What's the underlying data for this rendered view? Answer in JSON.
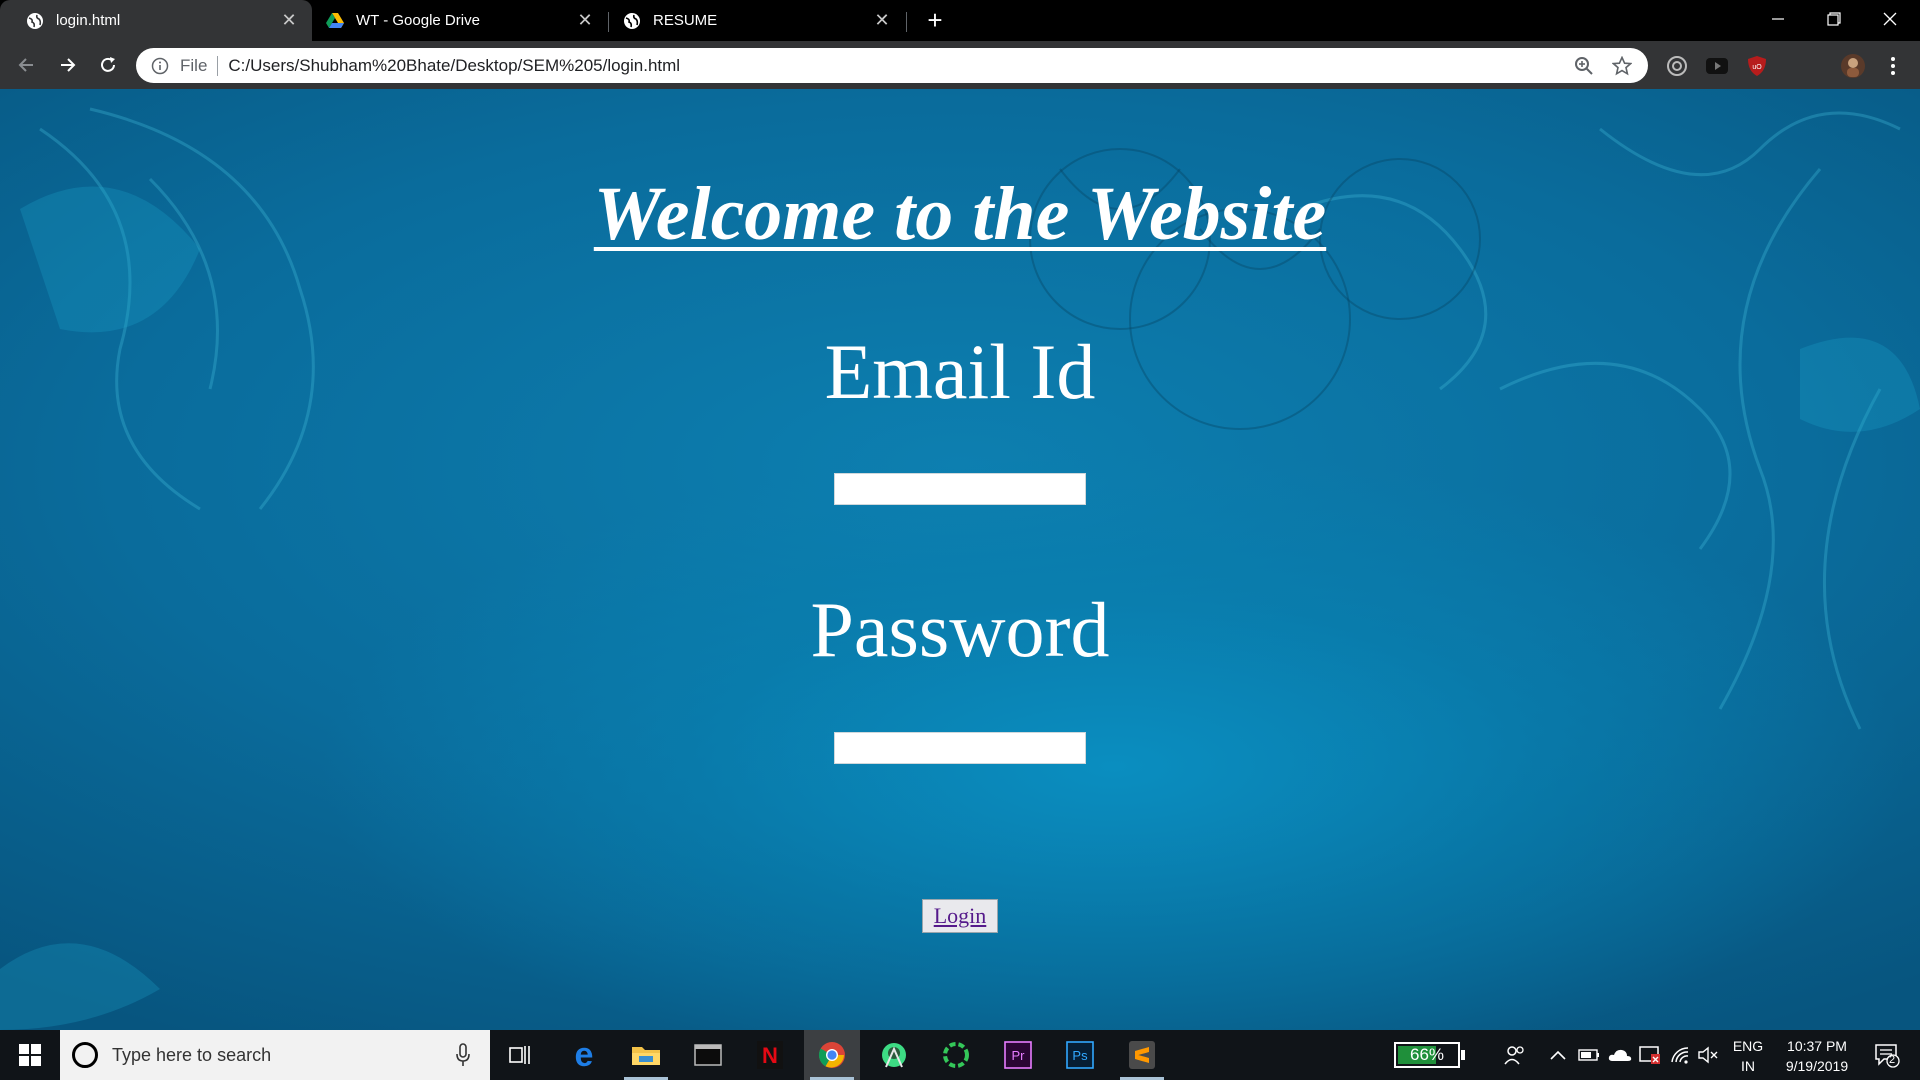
{
  "browser": {
    "tabs": [
      {
        "title": "login.html",
        "active": true
      },
      {
        "title": "WT - Google Drive",
        "active": false
      },
      {
        "title": "RESUME",
        "active": false
      }
    ],
    "new_tab_label": "+",
    "address_scheme": "File",
    "address_url": "C:/Users/Shubham%20Bhate/Desktop/SEM%205/login.html"
  },
  "page": {
    "title": "Welcome to the Website",
    "email_label": "Email Id",
    "email_value": "",
    "password_label": "Password",
    "password_value": "",
    "login_button": "Login"
  },
  "taskbar": {
    "search_placeholder": "Type here to search",
    "pinned": [
      "task-view-icon",
      "edge-icon",
      "file-explorer-icon",
      "terminal-icon",
      "netflix-icon",
      "chrome-icon",
      "android-studio-icon",
      "green-circle-app-icon",
      "premiere-pro-icon",
      "photoshop-icon",
      "sublime-text-icon"
    ],
    "battery_percent": "66%",
    "battery_level": 0.66,
    "language_top": "ENG",
    "language_bottom": "IN",
    "time": "10:37 PM",
    "date": "9/19/2019",
    "notification_count": "2"
  },
  "colors": {
    "page_background": "#0a78a8",
    "link_purple": "#551a8b",
    "battery_green": "#1f8f3a"
  }
}
